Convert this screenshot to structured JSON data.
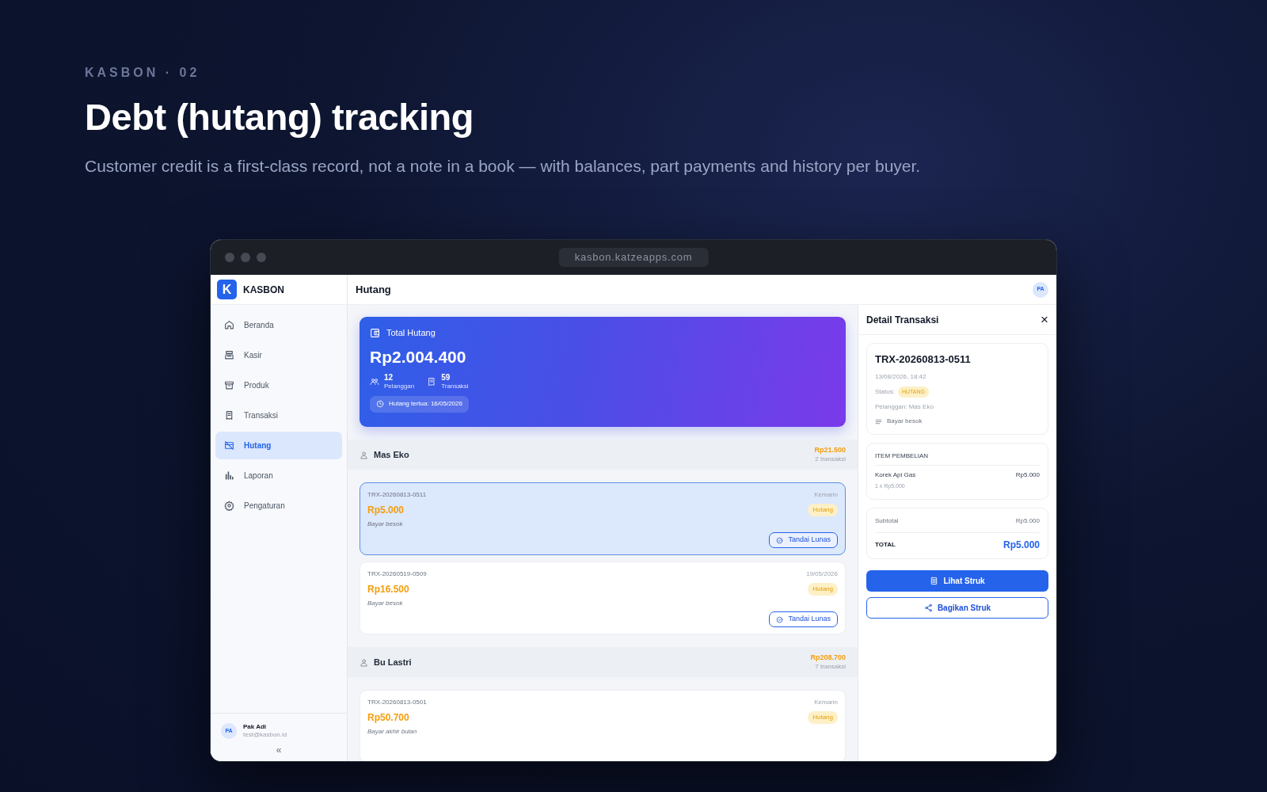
{
  "hero": {
    "eyebrow": "KASBON · 02",
    "title": "Debt (hutang) tracking",
    "subtitle": "Customer credit is a first-class record, not a note in a book — with balances, part payments and history per buyer."
  },
  "browser": {
    "url": "kasbon.katzeapps.com"
  },
  "sidebar": {
    "logo_letter": "K",
    "brand": "KASBON",
    "items": [
      {
        "label": "Beranda",
        "selected": false
      },
      {
        "label": "Kasir",
        "selected": false
      },
      {
        "label": "Produk",
        "selected": false
      },
      {
        "label": "Transaksi",
        "selected": false
      },
      {
        "label": "Hutang",
        "selected": true
      },
      {
        "label": "Laporan",
        "selected": false
      },
      {
        "label": "Pengaturan",
        "selected": false
      }
    ],
    "user": {
      "initials": "PA",
      "name": "Pak Adi",
      "email": "test@kasbon.id"
    },
    "collapse": "«"
  },
  "topbar": {
    "title": "Hutang",
    "avatar": "PA"
  },
  "summary": {
    "label": "Total Hutang",
    "amount": "Rp2.004.400",
    "stats": [
      {
        "value": "12",
        "label": "Pelanggan"
      },
      {
        "value": "59",
        "label": "Transaksi"
      }
    ],
    "oldest": "Hutang tertua: 16/05/2026"
  },
  "customers": [
    {
      "name": "Mas Eko",
      "total": "Rp21.500",
      "count": "2 transaksi",
      "transactions": [
        {
          "id": "TRX-20260813-0511",
          "date": "Kemarin",
          "amount": "Rp5.000",
          "status": "Hutang",
          "note": "Bayar besok",
          "button": "Tandai Lunas",
          "selected": true
        },
        {
          "id": "TRX-20260519-0509",
          "date": "19/05/2026",
          "amount": "Rp16.500",
          "status": "Hutang",
          "note": "Bayar besok",
          "button": "Tandai Lunas",
          "selected": false
        }
      ]
    },
    {
      "name": "Bu Lastri",
      "total": "Rp208.700",
      "count": "7 transaksi",
      "transactions": [
        {
          "id": "TRX-20260813-0501",
          "date": "Kemarin",
          "amount": "Rp50.700",
          "status": "Hutang",
          "note": "Bayar akhir bulan",
          "selected": false
        }
      ]
    }
  ],
  "detail": {
    "title": "Detail Transaksi",
    "close": "×",
    "id": "TRX-20260813-0511",
    "datetime": "13/08/2026, 18:42",
    "status_label": "Status:",
    "status": "HUTANG",
    "customer": "Pelanggan: Mas Eko",
    "note": "Bayar besok",
    "items_title": "ITEM PEMBELIAN",
    "items": [
      {
        "name": "Korek Api Gas",
        "price": "Rp5.000",
        "qty": "1 x Rp5.000"
      }
    ],
    "subtotal_label": "Subtotal",
    "subtotal": "Rp5.000",
    "total_label": "TOTAL",
    "total": "Rp5.000",
    "buttons": [
      {
        "label": "Lihat Struk",
        "kind": "primary"
      },
      {
        "label": "Bagikan Struk",
        "kind": "outline"
      }
    ]
  }
}
